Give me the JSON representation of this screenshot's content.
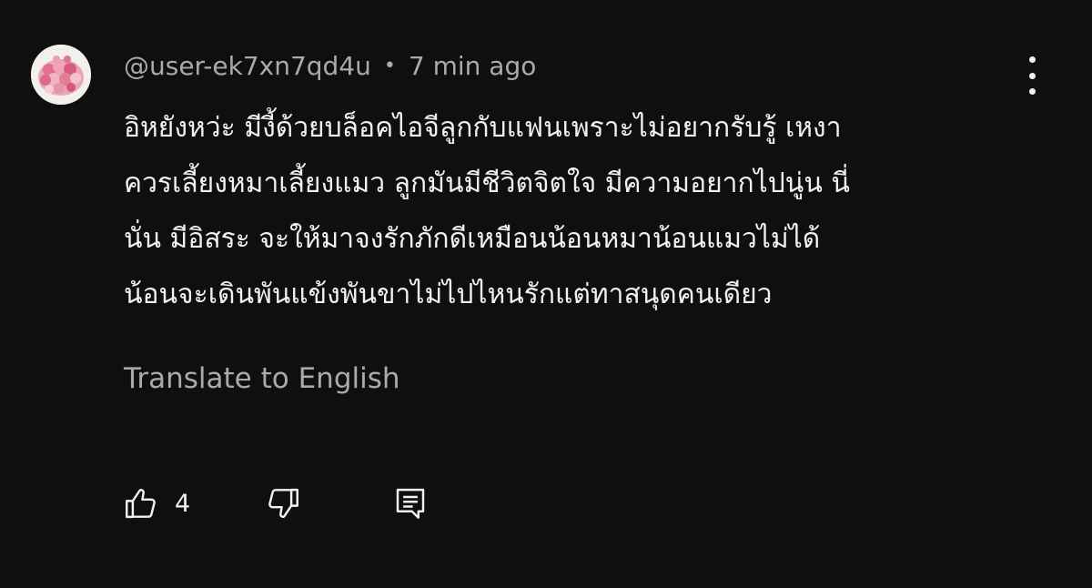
{
  "comment": {
    "author": "@user-ek7xn7qd4u",
    "separator": "•",
    "time": "7 min ago",
    "lines": [
      "อิหยังหว่ะ มีงี้ด้วยบล็อคไอจีลูกกับแฟนเพราะไม่อยากรับรู้ เหงา",
      "ควรเลี้ยงหมาเลี้ยงแมว ลูกมันมีชีวิตจิตใจ มีความอยากไปนู่น นี่",
      "นั่น มีอิสระ จะให้มาจงรักภักดีเหมือนน้อนหมาน้อนแมวไม่ได้",
      "น้อนจะเดินพันแข้งพันขาไม่ไปไหนรักแต่ทาสนุดคนเดียว"
    ],
    "translate_label": "Translate to English",
    "like_count": "4",
    "icons": {
      "avatar": "flower-bouquet-avatar",
      "more": "more-vert-icon",
      "like": "thumb-up-icon",
      "dislike": "thumb-down-icon",
      "reply": "comment-reply-icon"
    },
    "colors": {
      "background": "#0f0f0f",
      "text": "#f1f1f1",
      "secondary_text": "#aaaaaa"
    }
  }
}
